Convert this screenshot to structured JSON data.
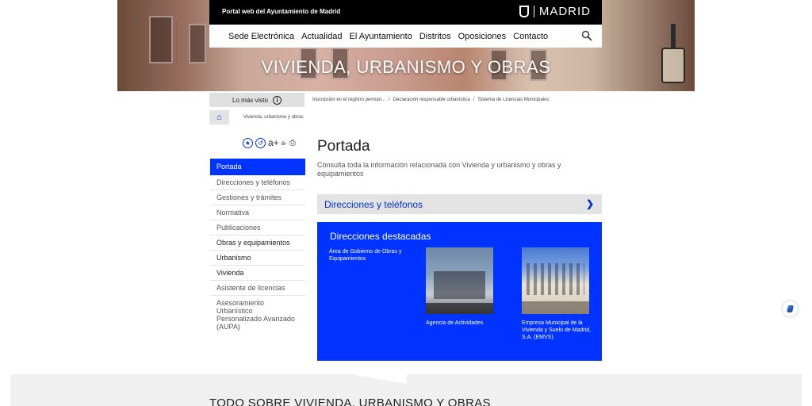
{
  "header": {
    "portal_label": "Portal web del Ayuntamiento de Madrid",
    "brand": "MADRID",
    "banner_title": "VIVIENDA, URBANISMO Y OBRAS"
  },
  "nav": {
    "items": [
      "Sede Electrónica",
      "Actualidad",
      "El Ayuntamiento",
      "Distritos",
      "Oposiciones",
      "Contacto"
    ],
    "search_icon": "search-icon"
  },
  "subbar": {
    "most_viewed": "Lo más visto",
    "info_glyph": "i",
    "links": [
      "Inscripción en el registro permán...",
      "/",
      "Declaración responsable urbanística",
      "/",
      "Sistema de Licencias Municipales"
    ]
  },
  "breadcrumb": {
    "home_icon": "home-icon",
    "current": "Vivienda, urbanismo y obras"
  },
  "tools": {
    "accessibility_icon": "star-icon",
    "share_icon": "share-icon",
    "font_up": "a+",
    "font_down": "a-",
    "print_icon": "print-icon"
  },
  "sidebar": {
    "items": [
      {
        "label": "Portada"
      },
      {
        "label": "Direcciones y teléfonos"
      },
      {
        "label": "Gestiones y trámites"
      },
      {
        "label": "Normativa"
      },
      {
        "label": "Publicaciones"
      },
      {
        "label": "Obras y equipamientos"
      },
      {
        "label": "Urbanismo"
      },
      {
        "label": "Vivienda"
      },
      {
        "label": "Asistente de licencias"
      },
      {
        "label": "Asesoramiento Urbanístico Personalizado Avanzado (AUPA)"
      }
    ]
  },
  "main": {
    "title": "Portada",
    "intro": "Consulta toda la información relacionada con Vivienda y urbanismo y obras y equipamientos",
    "directory_bar": "Direcciones y teléfonos",
    "featured": {
      "title": "Direcciones destacadas",
      "area": "Área de Gobierno de Obras y Equipamientos",
      "cards": [
        {
          "caption": "Agencia de Actividades"
        },
        {
          "caption": "Empresa Municipal de la Vivienda y Suelo de Madrid, S.A. (EMVS)"
        }
      ]
    }
  },
  "bottom": {
    "title": "TODO SOBRE VIVIENDA, URBANISMO Y OBRAS"
  },
  "colors": {
    "accent": "#0033ff",
    "link": "#0033cc",
    "topbar": "#000000",
    "grey": "#f0f0f0"
  }
}
